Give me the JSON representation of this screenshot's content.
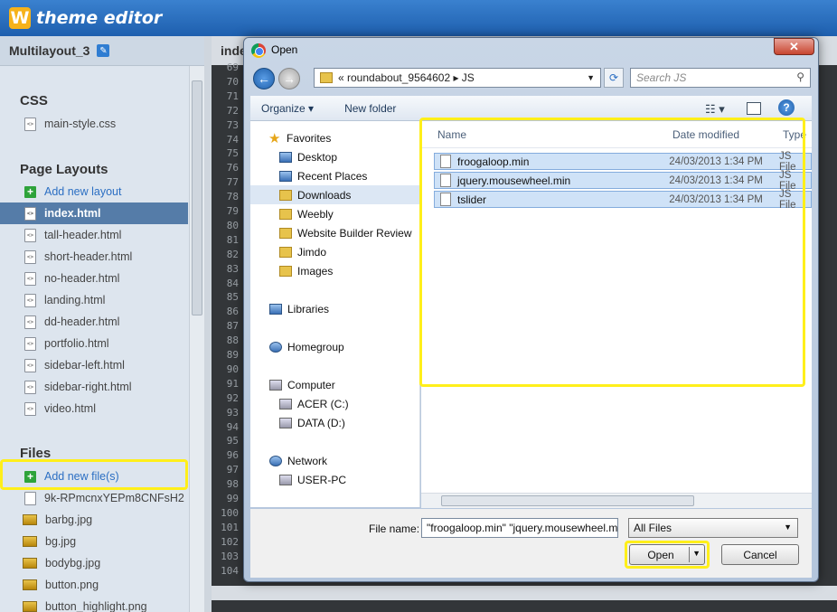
{
  "app": {
    "logo_letter": "W",
    "logo_text": "theme editor"
  },
  "sidebar": {
    "project": "Multilayout_3",
    "css_title": "CSS",
    "css_files": [
      "main-style.css"
    ],
    "layouts_title": "Page Layouts",
    "add_layout": "Add new layout",
    "layouts": [
      "index.html",
      "tall-header.html",
      "short-header.html",
      "no-header.html",
      "landing.html",
      "dd-header.html",
      "portfolio.html",
      "sidebar-left.html",
      "sidebar-right.html",
      "video.html"
    ],
    "selected_layout": "index.html",
    "files_title": "Files",
    "add_files": "Add new file(s)",
    "files": [
      "9k-RPmcnxYEPm8CNFsH2",
      "barbg.jpg",
      "bg.jpg",
      "bodybg.jpg",
      "button.png",
      "button_highlight.png"
    ]
  },
  "editor": {
    "tab": "inde",
    "lines": [
      "69",
      "70",
      "71",
      "72",
      "73",
      "74",
      "75",
      "76",
      "77",
      "78",
      "79",
      "80",
      "81",
      "82",
      "83",
      "84",
      "85",
      "86",
      "87",
      "88",
      "89",
      "90",
      "91",
      "92",
      "93",
      "94",
      "95",
      "96",
      "97",
      "98",
      "99",
      "100",
      "101",
      "102",
      "103",
      "104"
    ]
  },
  "dialog": {
    "title": "Open",
    "close": "✕",
    "breadcrumb": "«  roundabout_9564602  ▸  JS",
    "search_placeholder": "Search JS",
    "organize": "Organize ▾",
    "new_folder": "New folder",
    "help": "?",
    "nav": {
      "favorites": "Favorites",
      "fav_items": [
        "Desktop",
        "Recent Places",
        "Downloads",
        "Weebly",
        "Website Builder Review",
        "Jimdo",
        "Images"
      ],
      "libraries": "Libraries",
      "homegroup": "Homegroup",
      "computer": "Computer",
      "drives": [
        "ACER (C:)",
        "DATA (D:)"
      ],
      "network": "Network",
      "net_items": [
        "USER-PC"
      ]
    },
    "columns": {
      "name": "Name",
      "date": "Date modified",
      "type": "Type"
    },
    "files": [
      {
        "name": "froogaloop.min",
        "date": "24/03/2013 1:34 PM",
        "type": "JS File"
      },
      {
        "name": "jquery.mousewheel.min",
        "date": "24/03/2013 1:34 PM",
        "type": "JS File"
      },
      {
        "name": "tslider",
        "date": "24/03/2013 1:34 PM",
        "type": "JS File"
      }
    ],
    "file_name_label": "File name:",
    "file_name_value": "\"froogaloop.min\" \"jquery.mousewheel.min\" \"tslider\"",
    "file_type": "All Files",
    "open": "Open",
    "cancel": "Cancel"
  },
  "colors": {
    "highlight": "#ffef1a",
    "titlebar": "#1e5fae",
    "accent_link": "#2c6fc3"
  }
}
